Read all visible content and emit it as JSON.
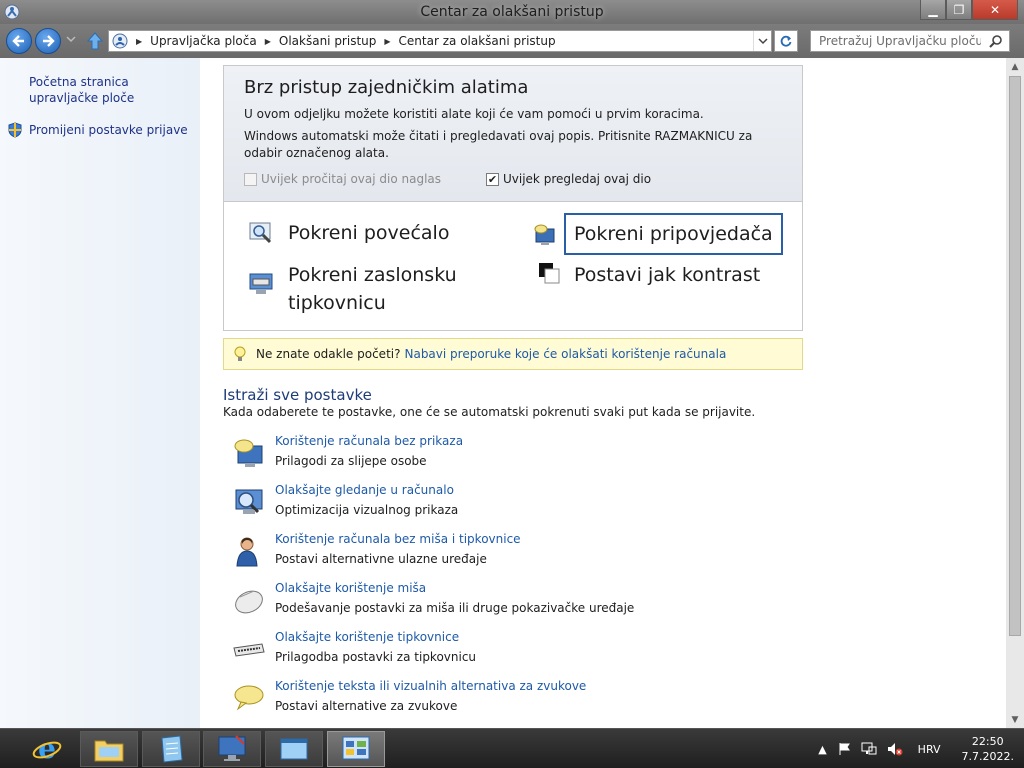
{
  "window": {
    "title": "Centar za olakšani pristup",
    "minimize": "▁",
    "maximize": "❐",
    "close": "✕"
  },
  "address": {
    "breadcrumbs": [
      "Upravljačka ploča",
      "Olakšani pristup",
      "Centar za olakšani pristup"
    ],
    "search_placeholder": "Pretražuj Upravljačku ploču"
  },
  "sidebar": {
    "items": [
      {
        "label": "Početna stranica upravljačke ploče"
      },
      {
        "label": "Promijeni postavke prijave",
        "icon": "shield-icon"
      }
    ]
  },
  "quick_access": {
    "title": "Brz pristup zajedničkim alatima",
    "line1": "U ovom odjeljku možete koristiti alate koji će vam pomoći u prvim koracima.",
    "line2": "Windows automatski može čitati i pregledavati ovaj popis. Pritisnite RAZMAKNICU za odabir označenog alata.",
    "checkbox_read": {
      "label": "Uvijek pročitaj ovaj dio naglas",
      "checked": false,
      "enabled": false
    },
    "checkbox_scan": {
      "label": "Uvijek pregledaj ovaj dio",
      "checked": true,
      "enabled": true,
      "check_mark": "✔"
    },
    "tools": {
      "magnifier": "Pokreni povećalo",
      "narrator": "Pokreni pripovjedača",
      "keyboard": "Pokreni zaslonsku tipkovnicu",
      "contrast": "Postavi jak kontrast"
    }
  },
  "tip": {
    "question": "Ne znate odakle početi?",
    "link": "Nabavi preporuke koje će olakšati korištenje računala"
  },
  "explore": {
    "title": "Istraži sve postavke",
    "subtitle": "Kada odaberete te postavke, one će se automatski pokrenuti svaki put kada se prijavite.",
    "items": [
      {
        "link": "Korištenje računala bez prikaza",
        "desc": "Prilagodi za slijepe osobe",
        "icon": "speech-monitor-icon"
      },
      {
        "link": "Olakšajte gledanje u računalo",
        "desc": "Optimizacija vizualnog prikaza",
        "icon": "magnify-monitor-icon"
      },
      {
        "link": "Korištenje računala bez miša i tipkovnice",
        "desc": "Postavi alternativne ulazne uređaje",
        "icon": "person-icon"
      },
      {
        "link": "Olakšajte korištenje miša",
        "desc": "Podešavanje postavki za miša ili druge pokazivačke uređaje",
        "icon": "mouse-icon"
      },
      {
        "link": "Olakšajte korištenje tipkovnice",
        "desc": "Prilagodba postavki za tipkovnicu",
        "icon": "keyboard-icon"
      },
      {
        "link": "Korištenje teksta ili vizualnih alternativa za zvukove",
        "desc": "Postavi alternative za zvukove",
        "icon": "speech-bubble-icon"
      }
    ]
  },
  "taskbar": {
    "language": "HRV",
    "time": "22:50",
    "date": "7.7.2022."
  },
  "colors": {
    "link": "#1e5aa8",
    "tip_bg": "#fffbd5",
    "focus": "#2a5fa8"
  }
}
